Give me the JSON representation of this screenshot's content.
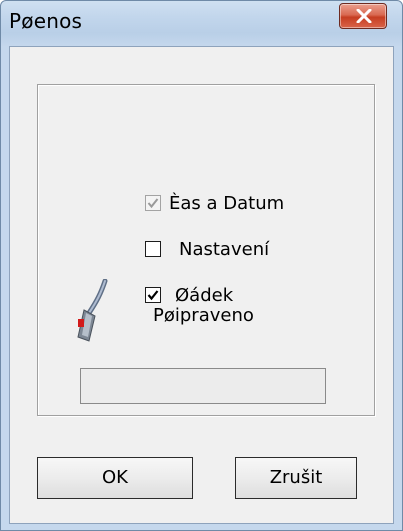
{
  "window": {
    "title": "Pøenos",
    "close_icon": "close-x-icon"
  },
  "options": [
    {
      "label": "Èas a Datum",
      "checked": true,
      "enabled": false
    },
    {
      "label": "Nastavení",
      "checked": false,
      "enabled": true
    },
    {
      "label": "Øádek",
      "checked": true,
      "enabled": true
    }
  ],
  "status": {
    "icon": "serial-cable-icon",
    "text": "Pøipraveno",
    "progress": 0
  },
  "buttons": {
    "ok_label": "OK",
    "cancel_label": "Zrušit"
  },
  "colors": {
    "close_button": "#d1492f",
    "dialog_background": "#f0f0f0",
    "title_bar": "#c2d6ec"
  }
}
